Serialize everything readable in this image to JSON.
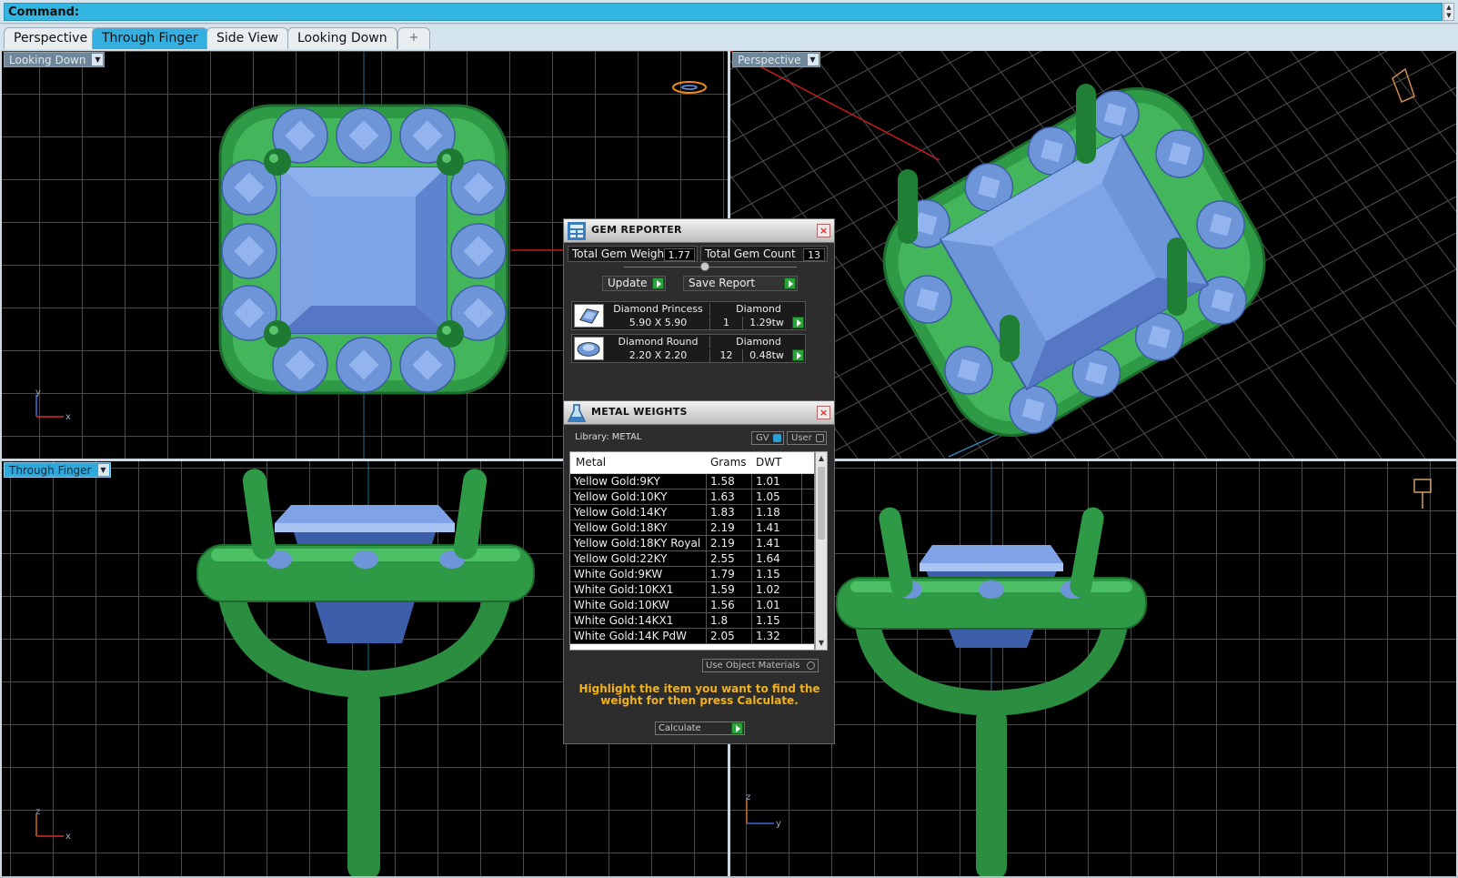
{
  "command": {
    "label": "Command:"
  },
  "tabs": [
    {
      "label": "Perspective"
    },
    {
      "label": "Through Finger"
    },
    {
      "label": "Side View"
    },
    {
      "label": "Looking Down"
    },
    {
      "label": "+"
    }
  ],
  "viewports": {
    "top_left": {
      "label": "Looking Down",
      "axes": [
        "y",
        "x"
      ]
    },
    "top_right": {
      "label": "Perspective"
    },
    "bottom_left": {
      "label": "Through Finger",
      "axes": [
        "z",
        "x"
      ]
    },
    "bottom_right": {
      "label": "",
      "axes": [
        "z",
        "y"
      ]
    }
  },
  "gem_reporter": {
    "title": "GEM REPORTER",
    "total_weight_label": "Total Gem Weight",
    "total_weight": "1.77",
    "total_count_label": "Total Gem Count",
    "total_count": "13",
    "update_label": "Update",
    "save_label": "Save Report",
    "items": [
      {
        "name": "Diamond Princess",
        "material": "Diamond",
        "size": "5.90 X 5.90",
        "count": "1",
        "weight": "1.29tw"
      },
      {
        "name": "Diamond Round",
        "material": "Diamond",
        "size": "2.20 X 2.20",
        "count": "12",
        "weight": "0.48tw"
      }
    ]
  },
  "metal_weights": {
    "title": "METAL WEIGHTS",
    "library": "Library: METAL",
    "gv_label": "GV",
    "user_label": "User",
    "columns": [
      "Metal",
      "Grams",
      "DWT"
    ],
    "rows": [
      [
        "Yellow Gold:9KY",
        "1.58",
        "1.01"
      ],
      [
        "Yellow Gold:10KY",
        "1.63",
        "1.05"
      ],
      [
        "Yellow Gold:14KY",
        "1.83",
        "1.18"
      ],
      [
        "Yellow Gold:18KY",
        "2.19",
        "1.41"
      ],
      [
        "Yellow Gold:18KY Royal",
        "2.19",
        "1.41"
      ],
      [
        "Yellow Gold:22KY",
        "2.55",
        "1.64"
      ],
      [
        "White Gold:9KW",
        "1.79",
        "1.15"
      ],
      [
        "White Gold:10KX1",
        "1.59",
        "1.02"
      ],
      [
        "White Gold:10KW",
        "1.56",
        "1.01"
      ],
      [
        "White Gold:14KX1",
        "1.8",
        "1.15"
      ],
      [
        "White Gold:14K PdW",
        "2.05",
        "1.32"
      ]
    ],
    "use_object_label": "Use Object Materials",
    "hint": "Highlight the item you want to find the weight for then press Calculate.",
    "calculate_label": "Calculate"
  },
  "colors": {
    "metal_green": "#2f9a45",
    "gem_blue": "#6f95d9",
    "accent_blue": "#35aee0",
    "hint_orange": "#f0b21b"
  }
}
